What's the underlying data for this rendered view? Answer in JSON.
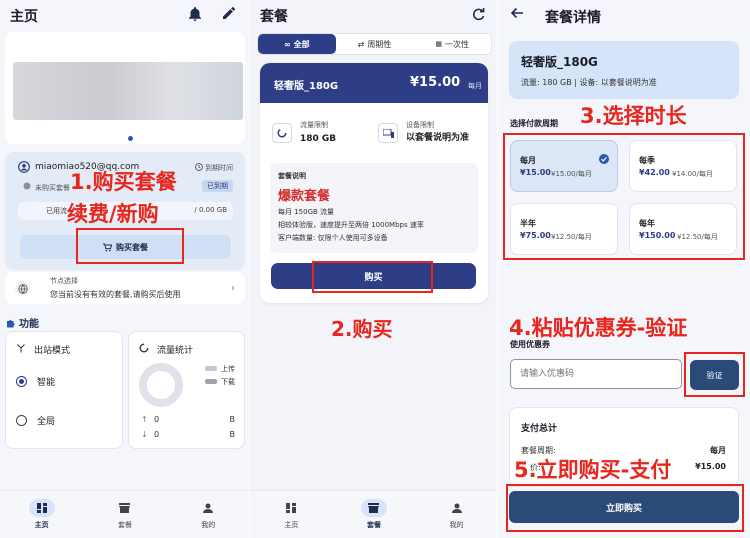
{
  "colors": {
    "primary": "#2d3d86",
    "accent": "#3a63d8",
    "annotation": "#e8261d",
    "price": "#d42f2f"
  },
  "home": {
    "title": "主页",
    "account": {
      "email": "miaomiao520@qq.com",
      "status_not_purchased": "未购买套餐",
      "expiry_label": "到期时间",
      "expired_badge": "已到期",
      "used_label": "已用流",
      "used_value": "/ 0.00 GB"
    },
    "buy_button": "购买套餐",
    "node": {
      "title": "节点选择",
      "desc": "您当前没有有效的套餐,请购买后使用"
    },
    "features_title": "功能",
    "outbound": {
      "title": "出站模式",
      "opt_smart": "智能",
      "opt_global": "全局"
    },
    "traffic": {
      "title": "流量统计",
      "upload": "上传",
      "download": "下载",
      "up_value": "0",
      "down_value": "0",
      "up_unit": "B",
      "down_unit": "B"
    },
    "nav": [
      {
        "label": "主页"
      },
      {
        "label": "套餐"
      },
      {
        "label": "我的"
      }
    ]
  },
  "plans": {
    "title": "套餐",
    "tabs": [
      {
        "label": "全部"
      },
      {
        "label": "周期性"
      },
      {
        "label": "一次性"
      }
    ],
    "card": {
      "name": "轻奢版_180G",
      "price": "¥15.00",
      "period": "每月",
      "traffic_label": "流量限制",
      "traffic_value": "180 GB",
      "device_label": "设备限制",
      "device_value": "以套餐说明为准",
      "desc_title": "套餐说明",
      "hot": "爆款套餐",
      "lines": [
        "每月 150GB 流量",
        "相较体验版，速度提升至两倍 1000Mbps 速率",
        "客户端数量: 仅限个人使用可多设备"
      ],
      "buy": "购买"
    }
  },
  "detail": {
    "title": "套餐详情",
    "plan_name": "轻奢版_180G",
    "plan_meta": "流量: 180 GB | 设备: 以套餐说明为准",
    "period_label": "选择付款周期",
    "periods": [
      {
        "name": "每月",
        "price": "¥15.00",
        "unit": "¥15.00/每月",
        "selected": true
      },
      {
        "name": "每季",
        "price": "¥42.00",
        "unit": "¥14.00/每月",
        "selected": false
      },
      {
        "name": "半年",
        "price": "¥75.00",
        "unit": "¥12.50/每月",
        "selected": false
      },
      {
        "name": "每年",
        "price": "¥150.00",
        "unit": "¥12.50/每月",
        "selected": false
      }
    ],
    "coupon_label": "使用优惠券",
    "coupon_placeholder": "请输入优惠码",
    "verify": "验证",
    "summary_title": "支付总计",
    "summary_period_label": "套餐周期:",
    "summary_period_value": "每月",
    "summary_price_label": "价:",
    "summary_price_value": "¥15.00",
    "buy_now": "立即购买"
  },
  "annotations": {
    "a1_line1": "1.购买套餐",
    "a1_line2": "续费/新购",
    "a2": "2.购买",
    "a3": "3.选择时长",
    "a4": "4.粘贴优惠券-验证",
    "a5": "5.立即购买-支付"
  }
}
